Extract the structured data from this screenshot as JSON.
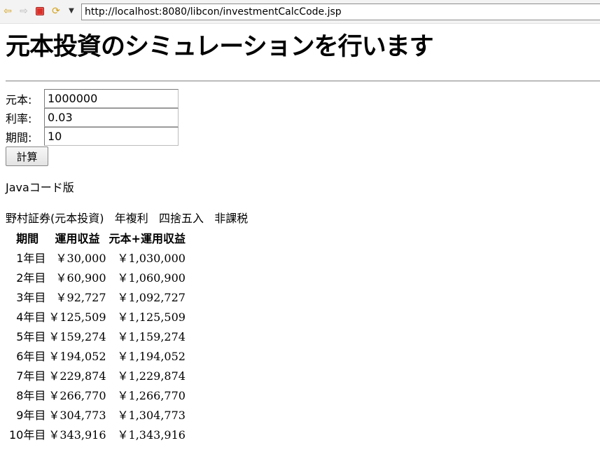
{
  "browser": {
    "url": "http://localhost:8080/libcon/investmentCalcCode.jsp",
    "back_icon": "back-arrow-icon",
    "forward_icon": "forward-arrow-icon",
    "stop_icon": "stop-icon",
    "refresh_icon": "refresh-icon",
    "menu_icon": "dropdown-arrow-icon"
  },
  "page": {
    "title": "元本投資のシミュレーションを行います"
  },
  "form": {
    "principal_label": "元本:",
    "principal_value": "1000000",
    "rate_label": "利率:",
    "rate_value": "0.03",
    "period_label": "期間:",
    "period_value": "10",
    "calc_button_label": "計算"
  },
  "result": {
    "version_text": "Javaコード版",
    "description": "野村証券(元本投資)   年複利   四捨五入   非課税",
    "headers": [
      "期間",
      "運用収益",
      "元本+運用収益"
    ],
    "rows": [
      [
        "1年目",
        "￥30,000",
        "￥1,030,000"
      ],
      [
        "2年目",
        "￥60,900",
        "￥1,060,900"
      ],
      [
        "3年目",
        "￥92,727",
        "￥1,092,727"
      ],
      [
        "4年目",
        "￥125,509",
        "￥1,125,509"
      ],
      [
        "5年目",
        "￥159,274",
        "￥1,159,274"
      ],
      [
        "6年目",
        "￥194,052",
        "￥1,194,052"
      ],
      [
        "7年目",
        "￥229,874",
        "￥1,229,874"
      ],
      [
        "8年目",
        "￥266,770",
        "￥1,266,770"
      ],
      [
        "9年目",
        "￥304,773",
        "￥1,304,773"
      ],
      [
        "10年目",
        "￥343,916",
        "￥1,343,916"
      ]
    ]
  }
}
